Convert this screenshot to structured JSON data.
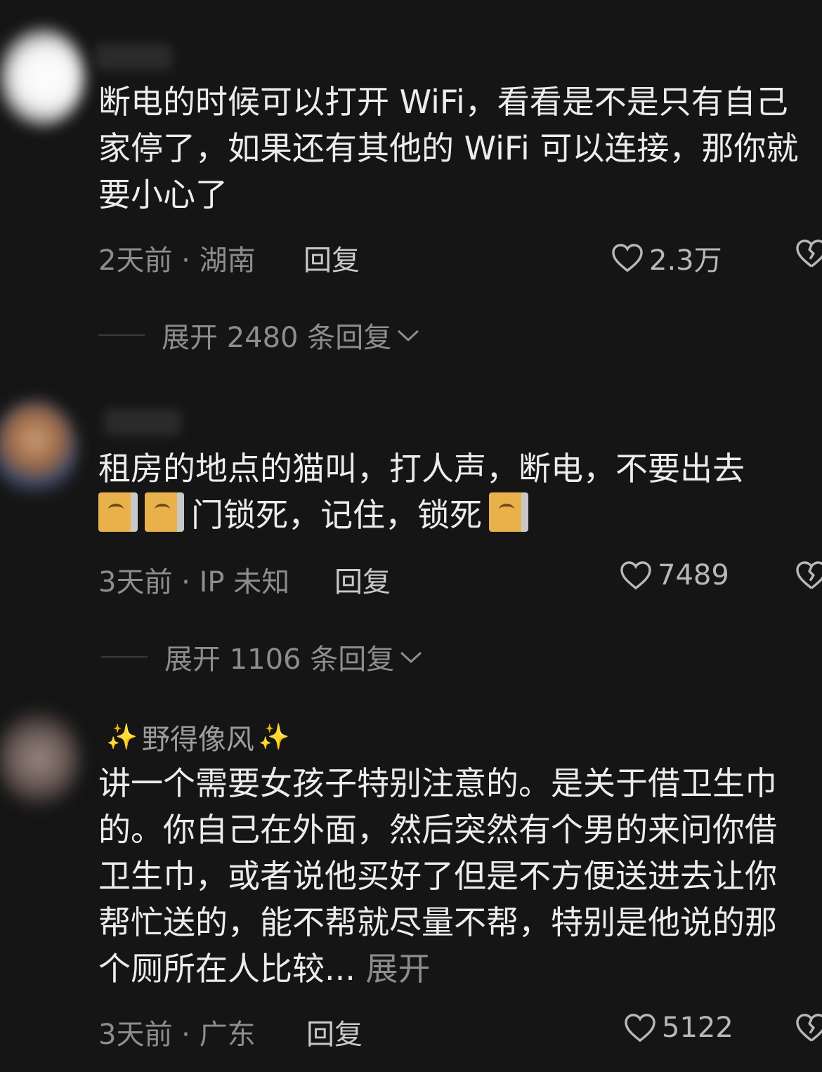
{
  "comments": [
    {
      "username": "",
      "text": "断电的时候可以打开 WiFi，看看是不是只有自己家停了，如果还有其他的 WiFi 可以连接，那你就要小心了",
      "time_location": "2天前 · 湖南",
      "reply_label": "回复",
      "likes": "2.3万",
      "expand_replies": "展开 2480 条回复"
    },
    {
      "username": "",
      "text_before_emoji": "租房的地点的猫叫，打人声，断电，不要出去",
      "text_middle": "门锁死，记住，锁死",
      "time_location": "3天前 · IP 未知",
      "reply_label": "回复",
      "likes": "7489",
      "expand_replies": "展开 1106 条回复",
      "emoji": "cat-emoji"
    },
    {
      "username": "野得像风",
      "text": "讲一个需要女孩子特别注意的。是关于借卫生巾的。你自己在外面，然后突然有个男的来问你借卫生巾，或者说他买好了但是不方便送进去让你帮忙送的，能不帮就尽量不帮，特别是他说的那个厕所在人比较...",
      "expand_label": "展开",
      "time_location": "3天前 · 广东",
      "reply_label": "回复",
      "likes": "5122"
    }
  ],
  "colors": {
    "background": "#151515",
    "text": "#ececec",
    "muted": "#8d8d8d",
    "sparkle": "#f5d04a"
  },
  "icons": {
    "like": "heart-outline-icon",
    "dislike": "broken-heart-icon",
    "expand": "chevron-down-icon",
    "sparkle": "sparkles-icon"
  }
}
